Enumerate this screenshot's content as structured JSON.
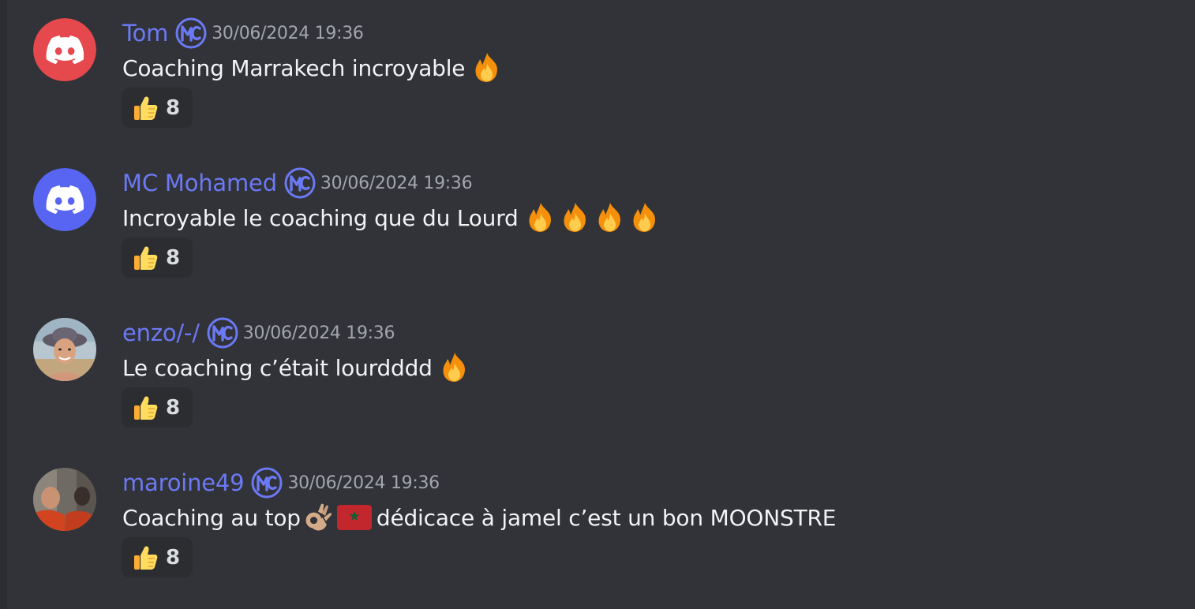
{
  "messages": [
    {
      "username": "Tom",
      "timestamp": "30/06/2024 19:36",
      "text": "Coaching Marrakech incroyable",
      "avatar_type": "discord-default-red",
      "avatar_color": "#e5484d",
      "emojis": [
        "fire"
      ],
      "reaction": {
        "emoji": "thumbs-up",
        "count": "8"
      }
    },
    {
      "username": "MC Mohamed",
      "timestamp": "30/06/2024 19:36",
      "text": "Incroyable le coaching que du Lourd",
      "avatar_type": "discord-default-blurple",
      "avatar_color": "#5865f2",
      "emojis": [
        "fire",
        "fire",
        "fire",
        "fire"
      ],
      "reaction": {
        "emoji": "thumbs-up",
        "count": "8"
      }
    },
    {
      "username": "enzo/-/",
      "timestamp": "30/06/2024 19:36",
      "text": "Le coaching c’était lourdddd",
      "avatar_type": "photo",
      "emojis": [
        "fire"
      ],
      "reaction": {
        "emoji": "thumbs-up",
        "count": "8"
      }
    },
    {
      "username": "maroine49",
      "timestamp": "30/06/2024 19:36",
      "text_before": "Coaching au top",
      "text_after": "dédicace à jamel c’est un bon MOONSTRE",
      "avatar_type": "photo",
      "emojis": [
        "ok-hand",
        "morocco-flag"
      ],
      "reaction": {
        "emoji": "thumbs-up",
        "count": "8"
      }
    }
  ],
  "colors": {
    "background": "#313338",
    "username": "#6b79f4",
    "timestamp": "#a3a6ad",
    "text": "#f2f3f5",
    "reaction_bg": "#2b2d31"
  }
}
